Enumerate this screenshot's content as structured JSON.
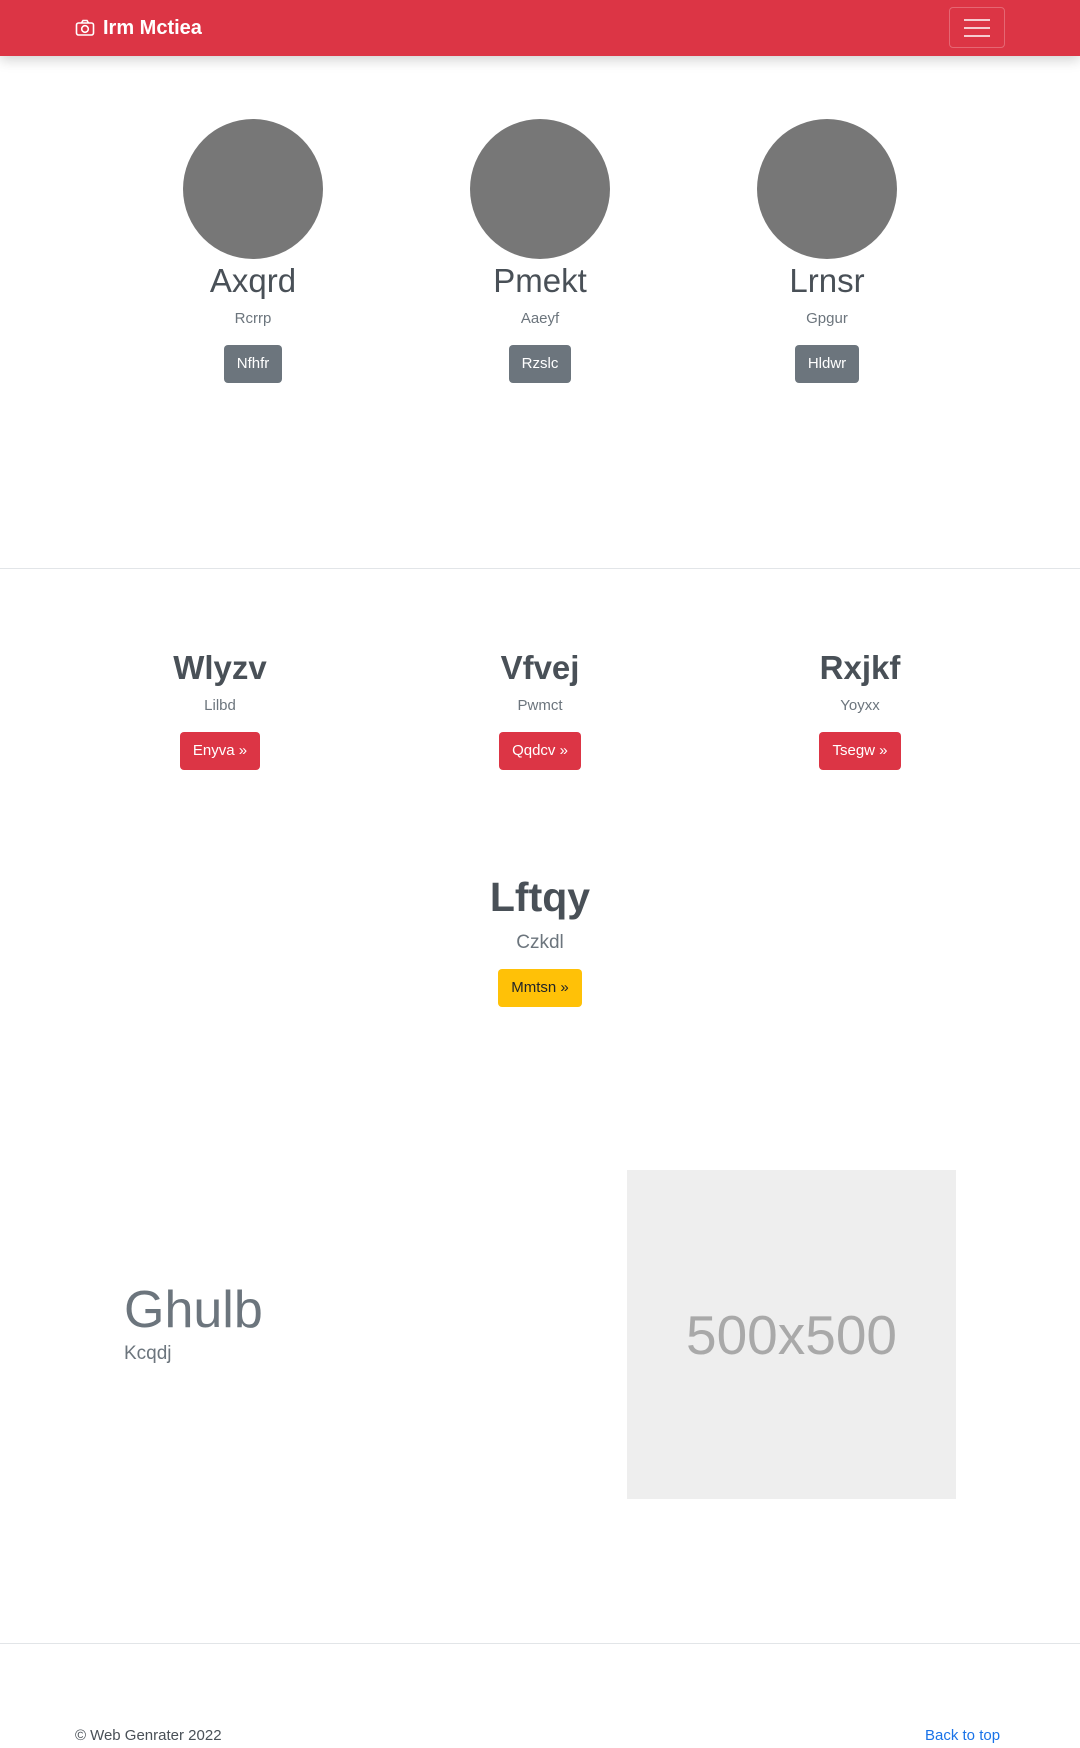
{
  "navbar": {
    "brand": "Irm Mctiea",
    "brand_icon": "camera-icon",
    "menu_icon": "hamburger-icon",
    "color": "#dc3545"
  },
  "profiles": [
    {
      "name": "Axqrd",
      "subtitle": "Rcrrp",
      "button": "Nfhfr"
    },
    {
      "name": "Pmekt",
      "subtitle": "Aaeyf",
      "button": "Rzslc"
    },
    {
      "name": "Lrnsr",
      "subtitle": "Gpgur",
      "button": "Hldwr"
    }
  ],
  "features": [
    {
      "title": "Wlyzv",
      "subtitle": "Lilbd",
      "button": "Enyva »"
    },
    {
      "title": "Vfvej",
      "subtitle": "Pwmct",
      "button": "Qqdcv »"
    },
    {
      "title": "Rxjkf",
      "subtitle": "Yoyxx",
      "button": "Tsegw »"
    }
  ],
  "cta": {
    "title": "Lftqy",
    "subtitle": "Czkdl",
    "button": "Mmtsn »"
  },
  "hero": {
    "title": "Ghulb",
    "subtitle": "Kcqdj",
    "placeholder": "500x500"
  },
  "footer": {
    "copyright_symbol": "©",
    "copyright": "Web Genrater 2022",
    "back_to_top": "Back to top"
  }
}
